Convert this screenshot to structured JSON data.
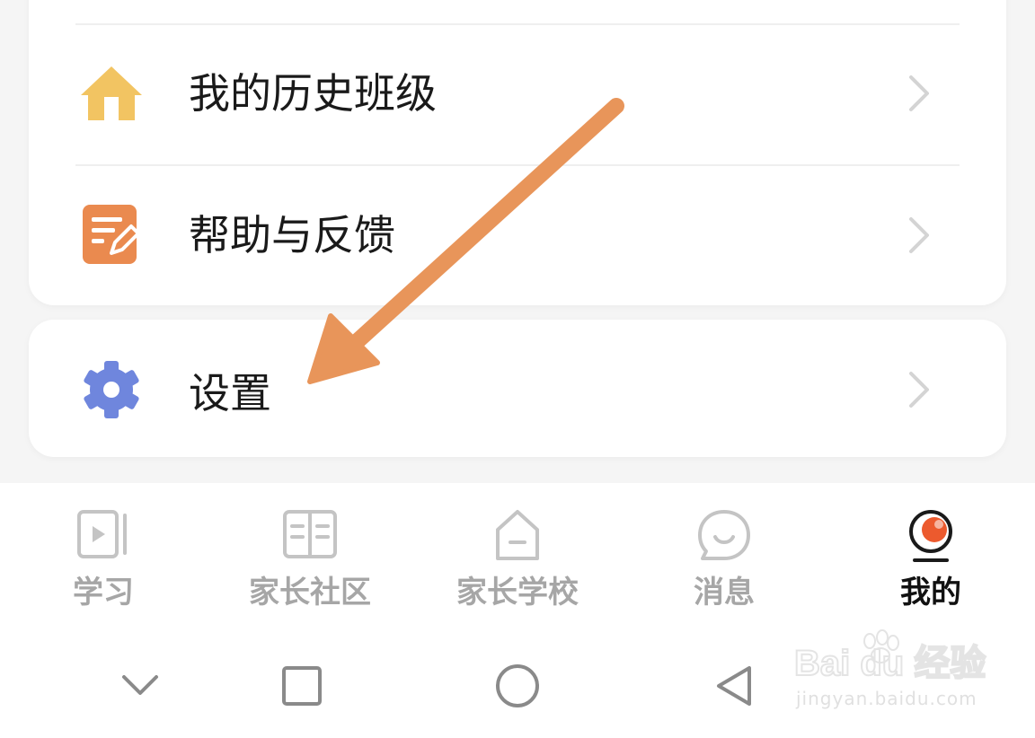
{
  "menu": {
    "items": [
      {
        "label": "我的历史班级",
        "icon": "house-icon"
      },
      {
        "label": "帮助与反馈",
        "icon": "feedback-note-icon"
      }
    ],
    "settings": {
      "label": "设置",
      "icon": "gear-icon"
    }
  },
  "tabbar": {
    "tabs": [
      {
        "label": "学习",
        "icon": "video-play-icon"
      },
      {
        "label": "家长社区",
        "icon": "open-book-icon"
      },
      {
        "label": "家长学校",
        "icon": "school-house-icon"
      },
      {
        "label": "消息",
        "icon": "smile-bubble-icon"
      },
      {
        "label": "我的",
        "icon": "profile-icon"
      }
    ],
    "active_tab": "我的"
  },
  "system_nav": [
    "chevron-down-icon",
    "square-icon",
    "circle-icon",
    "triangle-back-icon"
  ],
  "watermark": {
    "brand": "Bai du 经验",
    "url": "jingyan.baidu.com"
  },
  "colors": {
    "house_icon": "#f2c462",
    "feedback_icon": "#ea8a4f",
    "gear_icon": "#6f86dd",
    "annotation_arrow": "#e8955a",
    "profile_icon_accent": "#ec5a2e"
  }
}
